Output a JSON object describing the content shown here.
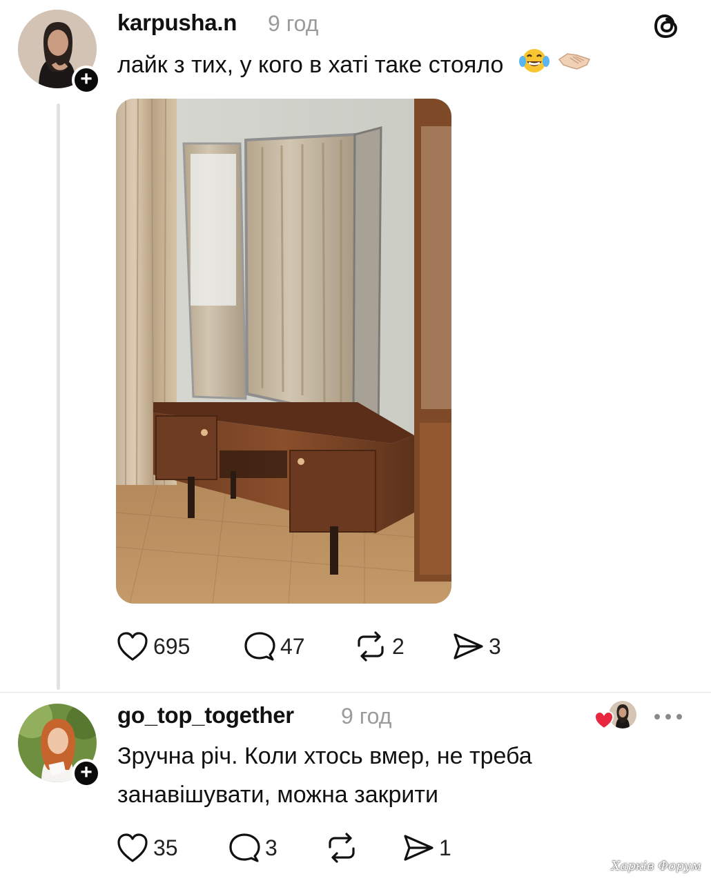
{
  "post": {
    "username": "karpusha.n",
    "time": "9 год",
    "text": "лайк з тих, у кого в хаті таке стояло",
    "emojis": [
      "laughing-tears-emoji",
      "handshake-emoji"
    ],
    "stats": {
      "likes": "695",
      "comments": "47",
      "reposts": "2",
      "shares": "3"
    }
  },
  "reply": {
    "username": "go_top_together",
    "time": "9 год",
    "text_line1": "Зручна річ. Коли хтось вмер, не треба",
    "text_line2": "занавішувати, можна закрити",
    "stats": {
      "likes": "35",
      "comments": "3",
      "reposts": "",
      "shares": "1"
    }
  },
  "watermark": "Харків Форум",
  "colors": {
    "accent_heart": "#e8263e",
    "muted": "#9b9b9b",
    "badge": "#0a0a0a"
  }
}
